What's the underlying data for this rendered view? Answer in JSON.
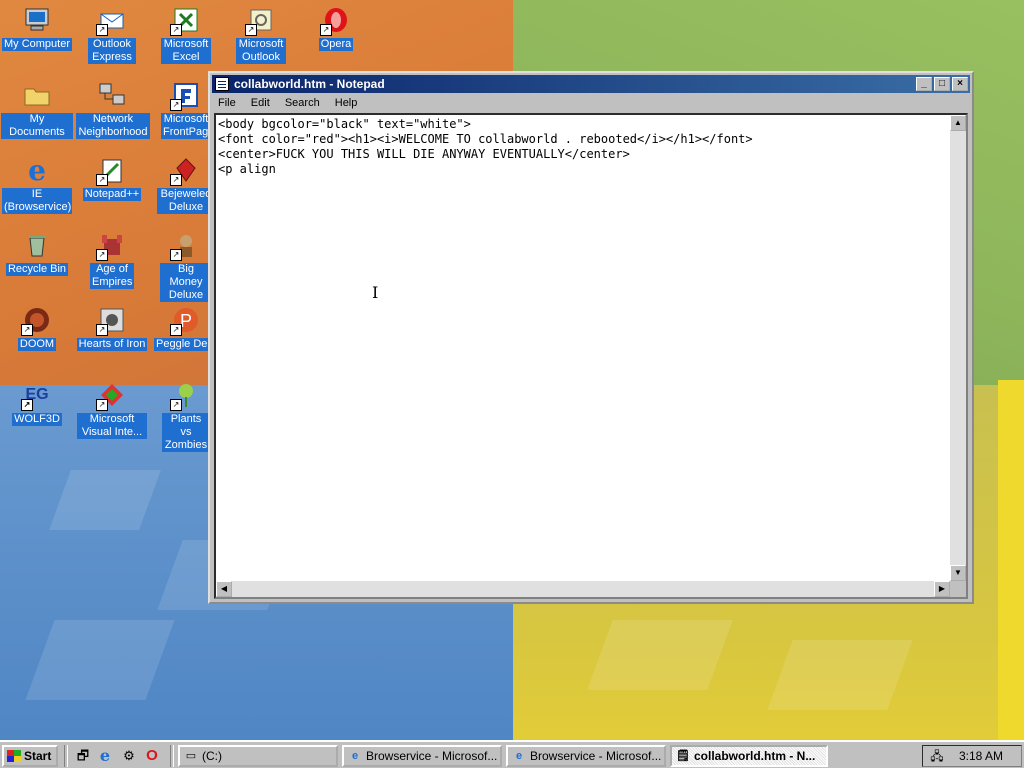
{
  "desktop": {
    "icons": [
      {
        "label": "My Computer",
        "icon": "computer-icon"
      },
      {
        "label": "Outlook Express",
        "icon": "outlook-express-icon"
      },
      {
        "label": "Microsoft Excel",
        "icon": "excel-icon"
      },
      {
        "label": "Microsoft Outlook",
        "icon": "outlook-icon"
      },
      {
        "label": "Opera",
        "icon": "opera-icon"
      },
      {
        "label": "My Documents",
        "icon": "folder-icon"
      },
      {
        "label": "Network Neighborhood",
        "icon": "network-icon"
      },
      {
        "label": "Microsoft FrontPage",
        "icon": "frontpage-icon"
      },
      {
        "label": "IE (Browservice)",
        "icon": "ie-icon"
      },
      {
        "label": "Notepad++",
        "icon": "notepad-plus-icon"
      },
      {
        "label": "Bejeweled Deluxe",
        "icon": "bejeweled-icon"
      },
      {
        "label": "Recycle Bin",
        "icon": "recycle-bin-icon"
      },
      {
        "label": "Age of Empires",
        "icon": "age-of-empires-icon"
      },
      {
        "label": "Big Money Deluxe",
        "icon": "big-money-icon"
      },
      {
        "label": "DOOM",
        "icon": "doom-icon"
      },
      {
        "label": "Hearts of Iron",
        "icon": "hearts-of-iron-icon"
      },
      {
        "label": "Peggle Delu",
        "icon": "peggle-icon"
      },
      {
        "label": "WOLF3D",
        "icon": "wolf3d-icon"
      },
      {
        "label": "Microsoft Visual Inte...",
        "icon": "visual-interdev-icon"
      },
      {
        "label": "Plants vs Zombies",
        "icon": "plants-vs-zombies-icon"
      }
    ]
  },
  "notepad": {
    "title": "collabworld.htm - Notepad",
    "menu": [
      "File",
      "Edit",
      "Search",
      "Help"
    ],
    "lines": [
      "<body bgcolor=\"black\" text=\"white\">",
      "<font color=\"red\"><h1><i>WELCOME TO collabworld . rebooted</i></h1></font>",
      "<center>FUCK YOU THIS WILL DIE ANYWAY EVENTUALLY</center>",
      "<p align"
    ]
  },
  "taskbar": {
    "start_label": "Start",
    "buttons": [
      {
        "label": "(C:)",
        "icon": "drive-icon"
      },
      {
        "label": "Browservice - Microsof...",
        "icon": "ie-icon"
      },
      {
        "label": "Browservice - Microsof...",
        "icon": "ie-icon"
      },
      {
        "label": "collabworld.htm - N...",
        "icon": "notepad-icon"
      }
    ],
    "clock": "3:18 AM"
  }
}
